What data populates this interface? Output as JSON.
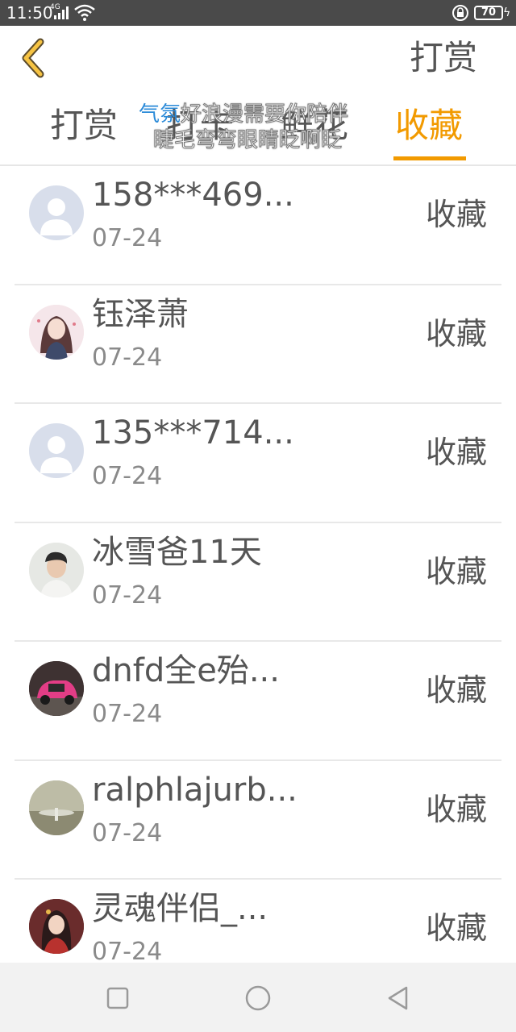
{
  "status_bar": {
    "time": "11:50",
    "network": "4G",
    "battery": "70"
  },
  "header": {
    "title": "打赏"
  },
  "tabs": [
    {
      "label": "打赏"
    },
    {
      "label": "打卡"
    },
    {
      "label": "鲜花"
    },
    {
      "label": "收藏",
      "active": true
    }
  ],
  "overlay_text": {
    "line1_accent": "气氛",
    "line1": "好浪漫需要你陪伴",
    "line2": "睫毛弯弯眼睛眨啊眨"
  },
  "list": [
    {
      "name": "158***469...",
      "date": "07-24",
      "action": "收藏",
      "avatar": "default-avatar"
    },
    {
      "name": "钰泽萧",
      "date": "07-24",
      "action": "收藏",
      "avatar": "anime-girl-avatar"
    },
    {
      "name": "135***714...",
      "date": "07-24",
      "action": "收藏",
      "avatar": "default-avatar"
    },
    {
      "name": "冰雪爸11天",
      "date": "07-24",
      "action": "收藏",
      "avatar": "young-man-avatar"
    },
    {
      "name": "dnfd全e殆...",
      "date": "07-24",
      "action": "收藏",
      "avatar": "pink-car-avatar"
    },
    {
      "name": "ralphlajurb...",
      "date": "07-24",
      "action": "收藏",
      "avatar": "landscape-avatar"
    },
    {
      "name": "灵魂伴侣_...",
      "date": "07-24",
      "action": "收藏",
      "avatar": "portrait-woman-avatar"
    }
  ],
  "colors": {
    "accent": "#f29a00",
    "status_bar": "#4a4a4a",
    "text": "#555555",
    "subtext": "#8a8a8a",
    "default_avatar_bg": "#d8deeb"
  }
}
